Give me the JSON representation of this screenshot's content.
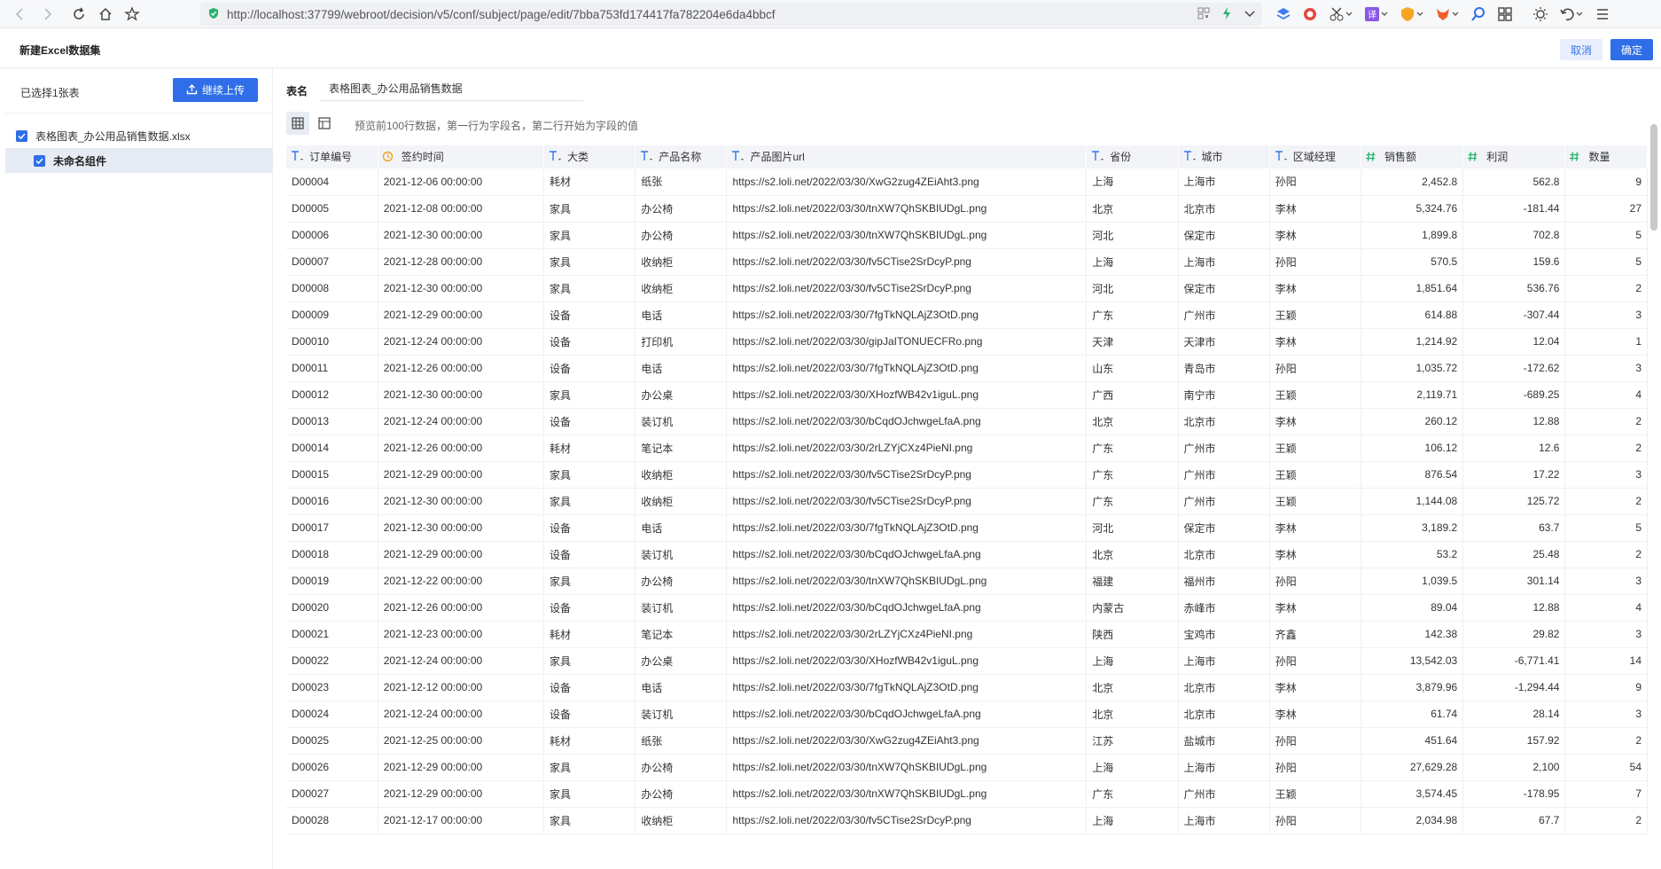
{
  "browser": {
    "url": "http://localhost:37799/webroot/decision/v5/conf/subject/page/edit/7bba753fd174417fa782204e6da4bbcf"
  },
  "app": {
    "title": "新建Excel数据集",
    "cancel_label": "取消",
    "ok_label": "确定"
  },
  "left": {
    "selected_count": "已选择1张表",
    "upload_label": "继续上传",
    "file_name": "表格图表_办公用品销售数据.xlsx",
    "sheet_name": "未命名组件"
  },
  "main": {
    "table_name_label": "表名",
    "table_name_value": "表格图表_办公用品销售数据",
    "preview_hint": "预览前100行数据，第一行为字段名，第二行开始为字段的值"
  },
  "table": {
    "columns": [
      {
        "name": "订单编号",
        "type": "text"
      },
      {
        "name": "签约时间",
        "type": "date"
      },
      {
        "name": "大类",
        "type": "text"
      },
      {
        "name": "产品名称",
        "type": "text"
      },
      {
        "name": "产品图片url",
        "type": "text"
      },
      {
        "name": "省份",
        "type": "text"
      },
      {
        "name": "城市",
        "type": "text"
      },
      {
        "name": "区域经理",
        "type": "text"
      },
      {
        "name": "销售额",
        "type": "number"
      },
      {
        "name": "利润",
        "type": "number"
      },
      {
        "name": "数量",
        "type": "number"
      }
    ],
    "rows": [
      [
        "D00004",
        "2021-12-06 00:00:00",
        "耗材",
        "纸张",
        "https://s2.loli.net/2022/03/30/XwG2zug4ZEiAht3.png",
        "上海",
        "上海市",
        "孙阳",
        "2,452.8",
        "562.8",
        "9"
      ],
      [
        "D00005",
        "2021-12-08 00:00:00",
        "家具",
        "办公椅",
        "https://s2.loli.net/2022/03/30/tnXW7QhSKBIUDgL.png",
        "北京",
        "北京市",
        "李林",
        "5,324.76",
        "-181.44",
        "27"
      ],
      [
        "D00006",
        "2021-12-30 00:00:00",
        "家具",
        "办公椅",
        "https://s2.loli.net/2022/03/30/tnXW7QhSKBIUDgL.png",
        "河北",
        "保定市",
        "李林",
        "1,899.8",
        "702.8",
        "5"
      ],
      [
        "D00007",
        "2021-12-28 00:00:00",
        "家具",
        "收纳柜",
        "https://s2.loli.net/2022/03/30/fv5CTise2SrDcyP.png",
        "上海",
        "上海市",
        "孙阳",
        "570.5",
        "159.6",
        "5"
      ],
      [
        "D00008",
        "2021-12-30 00:00:00",
        "家具",
        "收纳柜",
        "https://s2.loli.net/2022/03/30/fv5CTise2SrDcyP.png",
        "河北",
        "保定市",
        "李林",
        "1,851.64",
        "536.76",
        "2"
      ],
      [
        "D00009",
        "2021-12-29 00:00:00",
        "设备",
        "电话",
        "https://s2.loli.net/2022/03/30/7fgTkNQLAjZ3OtD.png",
        "广东",
        "广州市",
        "王颖",
        "614.88",
        "-307.44",
        "3"
      ],
      [
        "D00010",
        "2021-12-24 00:00:00",
        "设备",
        "打印机",
        "https://s2.loli.net/2022/03/30/gipJaITONUECFRo.png",
        "天津",
        "天津市",
        "李林",
        "1,214.92",
        "12.04",
        "1"
      ],
      [
        "D00011",
        "2021-12-26 00:00:00",
        "设备",
        "电话",
        "https://s2.loli.net/2022/03/30/7fgTkNQLAjZ3OtD.png",
        "山东",
        "青岛市",
        "孙阳",
        "1,035.72",
        "-172.62",
        "3"
      ],
      [
        "D00012",
        "2021-12-30 00:00:00",
        "家具",
        "办公桌",
        "https://s2.loli.net/2022/03/30/XHozfWB42v1iguL.png",
        "广西",
        "南宁市",
        "王颖",
        "2,119.71",
        "-689.25",
        "4"
      ],
      [
        "D00013",
        "2021-12-24 00:00:00",
        "设备",
        "装订机",
        "https://s2.loli.net/2022/03/30/bCqdOJchwgeLfaA.png",
        "北京",
        "北京市",
        "李林",
        "260.12",
        "12.88",
        "2"
      ],
      [
        "D00014",
        "2021-12-26 00:00:00",
        "耗材",
        "笔记本",
        "https://s2.loli.net/2022/03/30/2rLZYjCXz4PieNI.png",
        "广东",
        "广州市",
        "王颖",
        "106.12",
        "12.6",
        "2"
      ],
      [
        "D00015",
        "2021-12-29 00:00:00",
        "家具",
        "收纳柜",
        "https://s2.loli.net/2022/03/30/fv5CTise2SrDcyP.png",
        "广东",
        "广州市",
        "王颖",
        "876.54",
        "17.22",
        "3"
      ],
      [
        "D00016",
        "2021-12-30 00:00:00",
        "家具",
        "收纳柜",
        "https://s2.loli.net/2022/03/30/fv5CTise2SrDcyP.png",
        "广东",
        "广州市",
        "王颖",
        "1,144.08",
        "125.72",
        "2"
      ],
      [
        "D00017",
        "2021-12-30 00:00:00",
        "设备",
        "电话",
        "https://s2.loli.net/2022/03/30/7fgTkNQLAjZ3OtD.png",
        "河北",
        "保定市",
        "李林",
        "3,189.2",
        "63.7",
        "5"
      ],
      [
        "D00018",
        "2021-12-29 00:00:00",
        "设备",
        "装订机",
        "https://s2.loli.net/2022/03/30/bCqdOJchwgeLfaA.png",
        "北京",
        "北京市",
        "李林",
        "53.2",
        "25.48",
        "2"
      ],
      [
        "D00019",
        "2021-12-22 00:00:00",
        "家具",
        "办公椅",
        "https://s2.loli.net/2022/03/30/tnXW7QhSKBIUDgL.png",
        "福建",
        "福州市",
        "孙阳",
        "1,039.5",
        "301.14",
        "3"
      ],
      [
        "D00020",
        "2021-12-26 00:00:00",
        "设备",
        "装订机",
        "https://s2.loli.net/2022/03/30/bCqdOJchwgeLfaA.png",
        "内蒙古",
        "赤峰市",
        "李林",
        "89.04",
        "12.88",
        "4"
      ],
      [
        "D00021",
        "2021-12-23 00:00:00",
        "耗材",
        "笔记本",
        "https://s2.loli.net/2022/03/30/2rLZYjCXz4PieNI.png",
        "陕西",
        "宝鸡市",
        "齐鑫",
        "142.38",
        "29.82",
        "3"
      ],
      [
        "D00022",
        "2021-12-24 00:00:00",
        "家具",
        "办公桌",
        "https://s2.loli.net/2022/03/30/XHozfWB42v1iguL.png",
        "上海",
        "上海市",
        "孙阳",
        "13,542.03",
        "-6,771.41",
        "14"
      ],
      [
        "D00023",
        "2021-12-12 00:00:00",
        "设备",
        "电话",
        "https://s2.loli.net/2022/03/30/7fgTkNQLAjZ3OtD.png",
        "北京",
        "北京市",
        "李林",
        "3,879.96",
        "-1,294.44",
        "9"
      ],
      [
        "D00024",
        "2021-12-24 00:00:00",
        "设备",
        "装订机",
        "https://s2.loli.net/2022/03/30/bCqdOJchwgeLfaA.png",
        "北京",
        "北京市",
        "李林",
        "61.74",
        "28.14",
        "3"
      ],
      [
        "D00025",
        "2021-12-25 00:00:00",
        "耗材",
        "纸张",
        "https://s2.loli.net/2022/03/30/XwG2zug4ZEiAht3.png",
        "江苏",
        "盐城市",
        "孙阳",
        "451.64",
        "157.92",
        "2"
      ],
      [
        "D00026",
        "2021-12-29 00:00:00",
        "家具",
        "办公椅",
        "https://s2.loli.net/2022/03/30/tnXW7QhSKBIUDgL.png",
        "上海",
        "上海市",
        "孙阳",
        "27,629.28",
        "2,100",
        "54"
      ],
      [
        "D00027",
        "2021-12-29 00:00:00",
        "家具",
        "办公椅",
        "https://s2.loli.net/2022/03/30/tnXW7QhSKBIUDgL.png",
        "广东",
        "广州市",
        "王颖",
        "3,574.45",
        "-178.95",
        "7"
      ],
      [
        "D00028",
        "2021-12-17 00:00:00",
        "家具",
        "收纳柜",
        "https://s2.loli.net/2022/03/30/fv5CTise2SrDcyP.png",
        "上海",
        "上海市",
        "孙阳",
        "2,034.98",
        "67.7",
        "2"
      ]
    ]
  },
  "colors": {
    "primary": "#2f6ee8",
    "header_bg": "#f2f4f7",
    "selected_row": "#e7ebf3"
  }
}
